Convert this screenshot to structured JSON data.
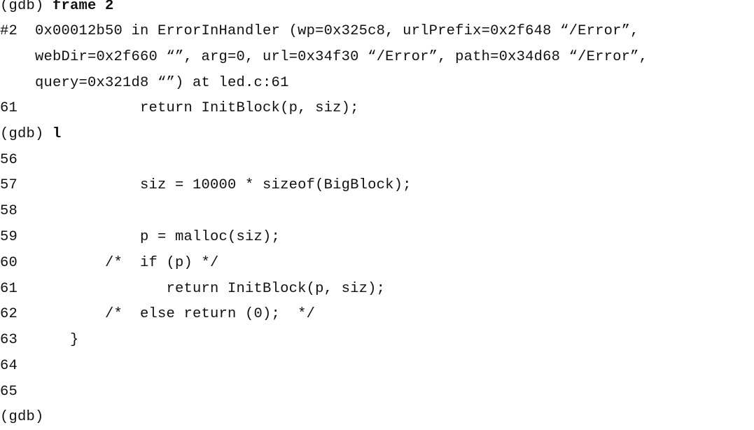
{
  "terminal": {
    "prompt": "(gdb)",
    "cmd1": "frame 2",
    "frame_line1": "#2  0x00012b50 in ErrorInHandler (wp=0x325c8, urlPrefix=0x2f648 “/Error”,",
    "frame_line2": "    webDir=0x2f660 “”, arg=0, url=0x34f30 “/Error”, path=0x34d68 “/Error”,",
    "frame_line3": "    query=0x321d8 “”) at led.c:61",
    "src_current": "61              return InitBlock(p, siz);",
    "cmd2": "l",
    "listing": [
      "56",
      "57              siz = 10000 * sizeof(BigBlock);",
      "58",
      "59              p = malloc(siz);",
      "60          /*  if (p) */",
      "61                 return InitBlock(p, siz);",
      "62          /*  else return (0);  */",
      "63      }",
      "64",
      "65"
    ],
    "final_prompt": "(gdb)"
  }
}
